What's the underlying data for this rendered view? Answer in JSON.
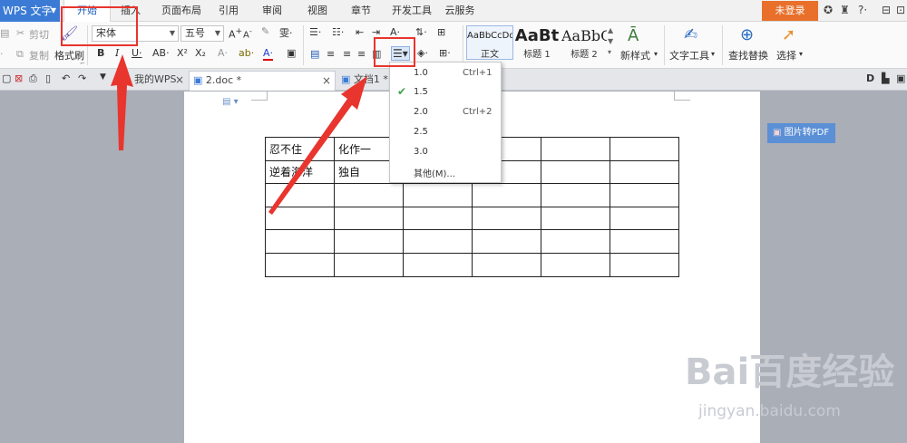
{
  "app": {
    "name": "WPS 文字"
  },
  "menubar": {
    "tabs": [
      "开始",
      "插入",
      "页面布局",
      "引用",
      "审阅",
      "视图",
      "章节",
      "开发工具",
      "云服务"
    ],
    "active_index": 0,
    "login": "未登录",
    "right_icons": [
      "skin-icon",
      "shirt-icon",
      "help-icon",
      "minimize-icon",
      "restore-icon"
    ]
  },
  "ribbon": {
    "clipboard": {
      "cut": "剪切",
      "copy": "复制",
      "format_painter": "格式刷"
    },
    "font": {
      "name": "宋体",
      "size": "五号"
    },
    "styles": [
      {
        "preview": "AaBbCcDd",
        "label": "正文"
      },
      {
        "preview": "AaBt",
        "label": "标题 1"
      },
      {
        "preview": "AaBbC",
        "label": "标题 2"
      }
    ],
    "new_style": "新样式",
    "text_tools": "文字工具",
    "find_replace": "查找替换",
    "select": "选择"
  },
  "tabbar": {
    "tabs": [
      "我的WPS",
      "2.doc *",
      "文档1 *"
    ],
    "active_index": 1
  },
  "document": {
    "table": [
      [
        "忍不住",
        "化作一",
        "",
        "",
        "",
        ""
      ],
      [
        "逆着海洋",
        "独自",
        "",
        "",
        "",
        ""
      ],
      [
        "",
        "",
        "",
        "",
        "",
        ""
      ],
      [
        "",
        "",
        "",
        "",
        "",
        ""
      ],
      [
        "",
        "",
        "",
        "",
        "",
        ""
      ],
      [
        "",
        "",
        "",
        "",
        "",
        ""
      ]
    ]
  },
  "pdf_button": "图片转PDF",
  "line_spacing_menu": {
    "items": [
      {
        "value": "1.0",
        "shortcut": "Ctrl+1",
        "checked": false
      },
      {
        "value": "1.5",
        "shortcut": "",
        "checked": true
      },
      {
        "value": "2.0",
        "shortcut": "Ctrl+2",
        "checked": false
      },
      {
        "value": "2.5",
        "shortcut": "",
        "checked": false
      },
      {
        "value": "3.0",
        "shortcut": "",
        "checked": false
      },
      {
        "value": "其他(M)...",
        "shortcut": "",
        "checked": false
      }
    ]
  },
  "watermark": {
    "main": "Bai百度经验",
    "url": "jingyan.baidu.com"
  },
  "colors": {
    "accent": "#3b7bd5",
    "login": "#e8702a",
    "highlight": "#e8352e",
    "pdf": "#5b8fd6"
  }
}
